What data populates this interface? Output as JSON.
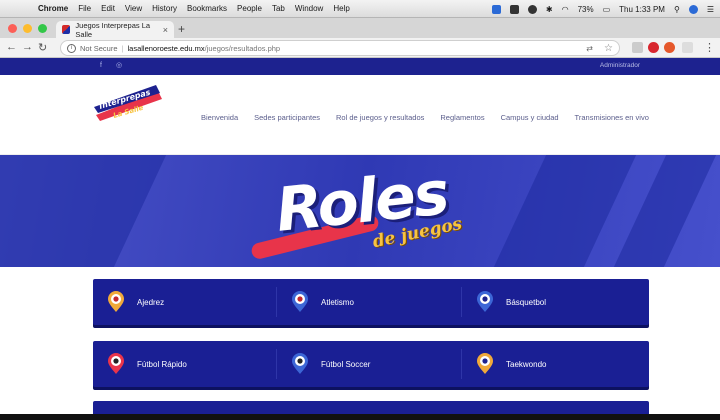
{
  "menubar": {
    "app": "Chrome",
    "items": [
      "File",
      "Edit",
      "View",
      "History",
      "Bookmarks",
      "People",
      "Tab",
      "Window",
      "Help"
    ],
    "battery": "73%",
    "clock": "Thu 1:33 PM"
  },
  "browser": {
    "tab_title": "Juegos Interprepas La Salle",
    "url_security": "Not Secure",
    "url_host": "lasallenoroeste.edu.mx",
    "url_path": "/juegos/resultados.php"
  },
  "site": {
    "admin_link": "Administrador",
    "logo_text": [
      "Juegos",
      "Interprepas",
      "La Salle"
    ],
    "nav": [
      "Bienvenida",
      "Sedes participantes",
      "Rol de juegos y resultados",
      "Reglamentos",
      "Campus y ciudad",
      "Transmisiones en vivo"
    ],
    "hero_title": "Roles",
    "hero_subtitle": "de juegos",
    "sports": [
      {
        "label": "Ajedrez",
        "pin_color": "#f0a93a"
      },
      {
        "label": "Atletismo",
        "pin_color": "#3c66d6"
      },
      {
        "label": "Básquetbol",
        "pin_color": "#3c66d6"
      },
      {
        "label": "Fútbol Rápido",
        "pin_color": "#e9344a"
      },
      {
        "label": "Fútbol Soccer",
        "pin_color": "#3c66d6"
      },
      {
        "label": "Taekwondo",
        "pin_color": "#f0a93a"
      }
    ]
  }
}
